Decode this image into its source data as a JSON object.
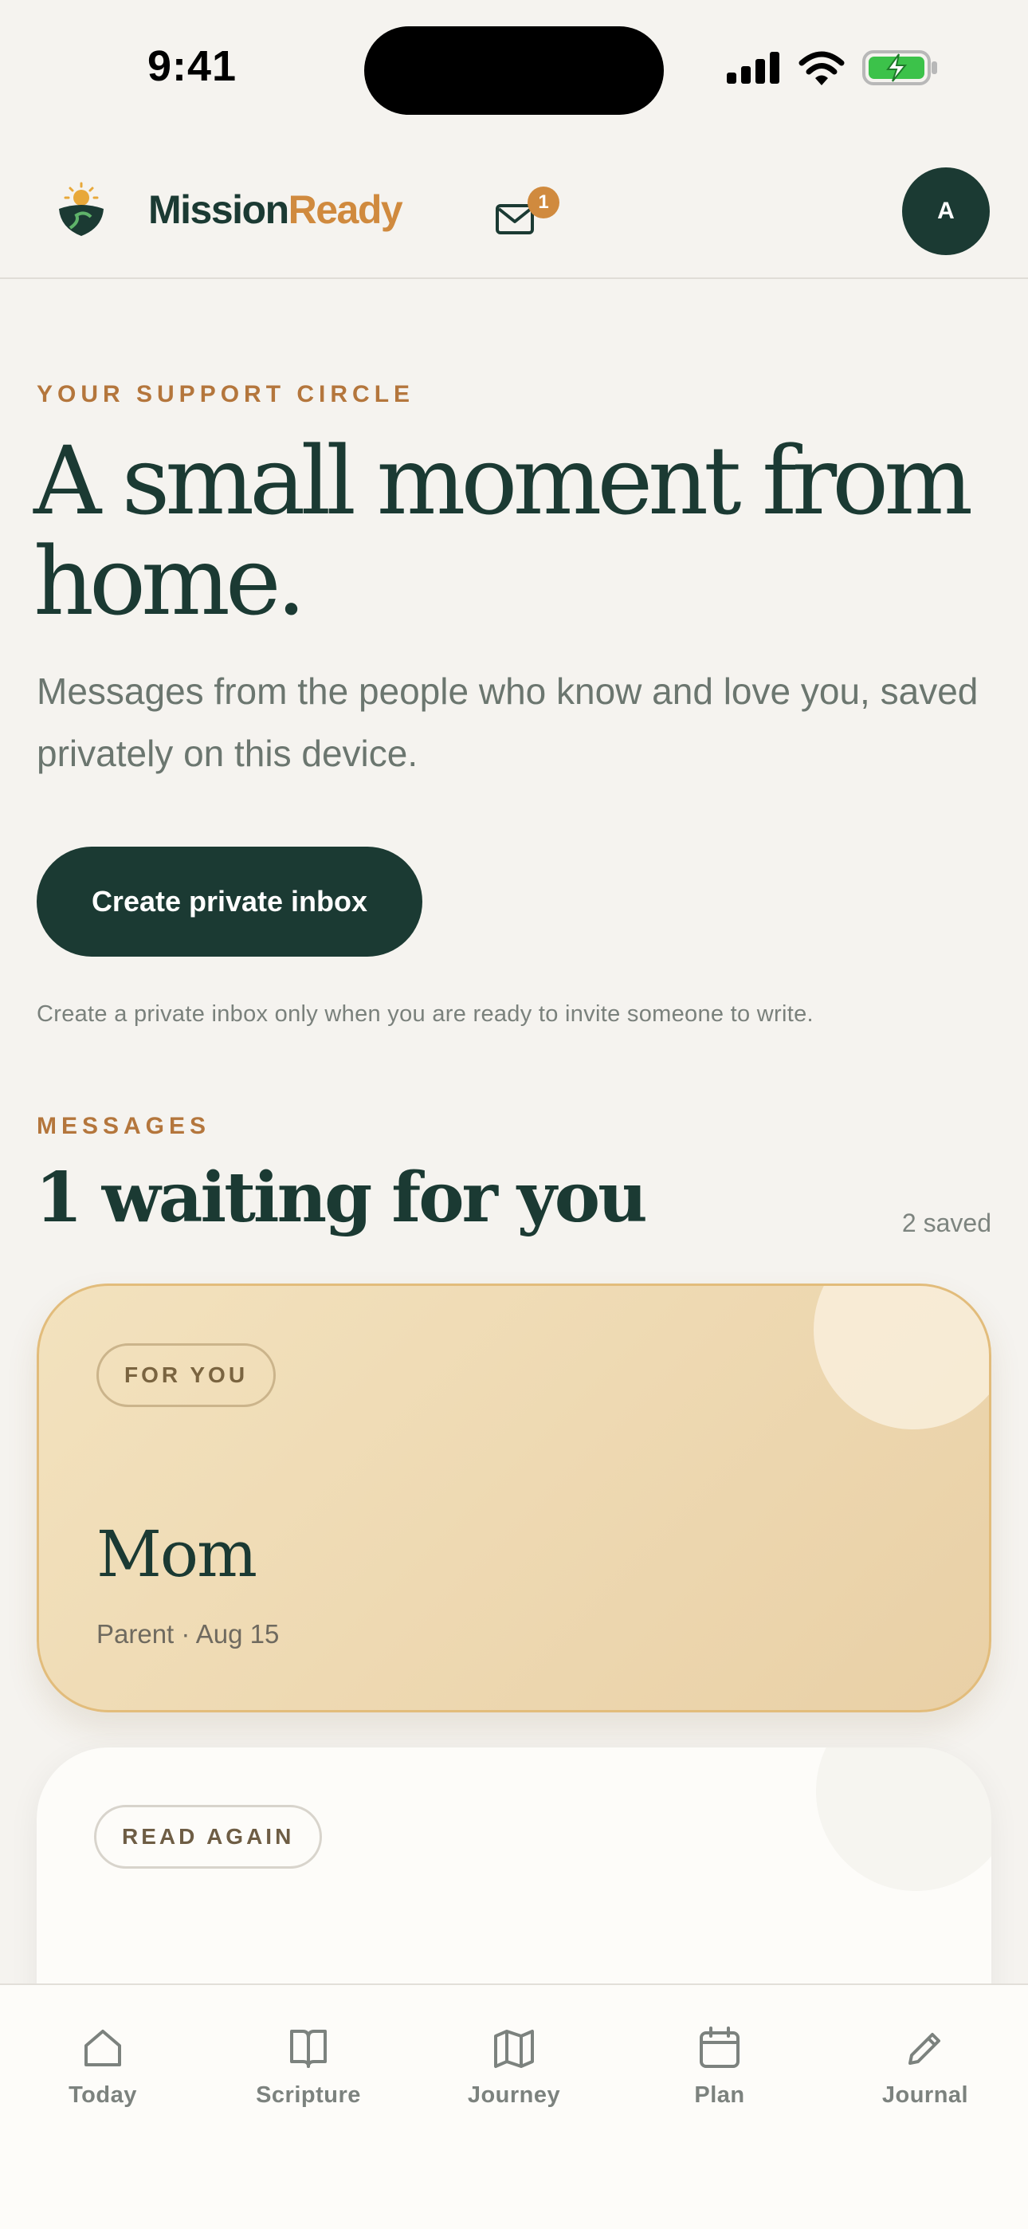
{
  "status_bar": {
    "time": "9:41"
  },
  "header": {
    "brand_part1": "Mission",
    "brand_part2": "Ready",
    "unread_count": "1",
    "avatar_initial": "A",
    "brand_color": "#1b3a33",
    "accent_color": "#d08a3e"
  },
  "hero": {
    "eyebrow": "YOUR SUPPORT CIRCLE",
    "title": "A small moment from home.",
    "subtitle": "Messages from the people who know and love you, saved privately on this device.",
    "button_label": "Create private inbox",
    "hint": "Create a private inbox only when you are ready to invite someone to write."
  },
  "messages": {
    "eyebrow": "MESSAGES",
    "title": "1 waiting for you",
    "saved_count": "2 saved",
    "cards": [
      {
        "tag": "FOR YOU",
        "name": "Mom",
        "meta": "Parent · Aug 15"
      },
      {
        "tag": "READ AGAIN"
      }
    ]
  },
  "bottom_nav": [
    {
      "label": "Today",
      "icon": "home-icon"
    },
    {
      "label": "Scripture",
      "icon": "book-icon"
    },
    {
      "label": "Journey",
      "icon": "map-icon"
    },
    {
      "label": "Plan",
      "icon": "calendar-icon"
    },
    {
      "label": "Journal",
      "icon": "pencil-icon"
    }
  ]
}
